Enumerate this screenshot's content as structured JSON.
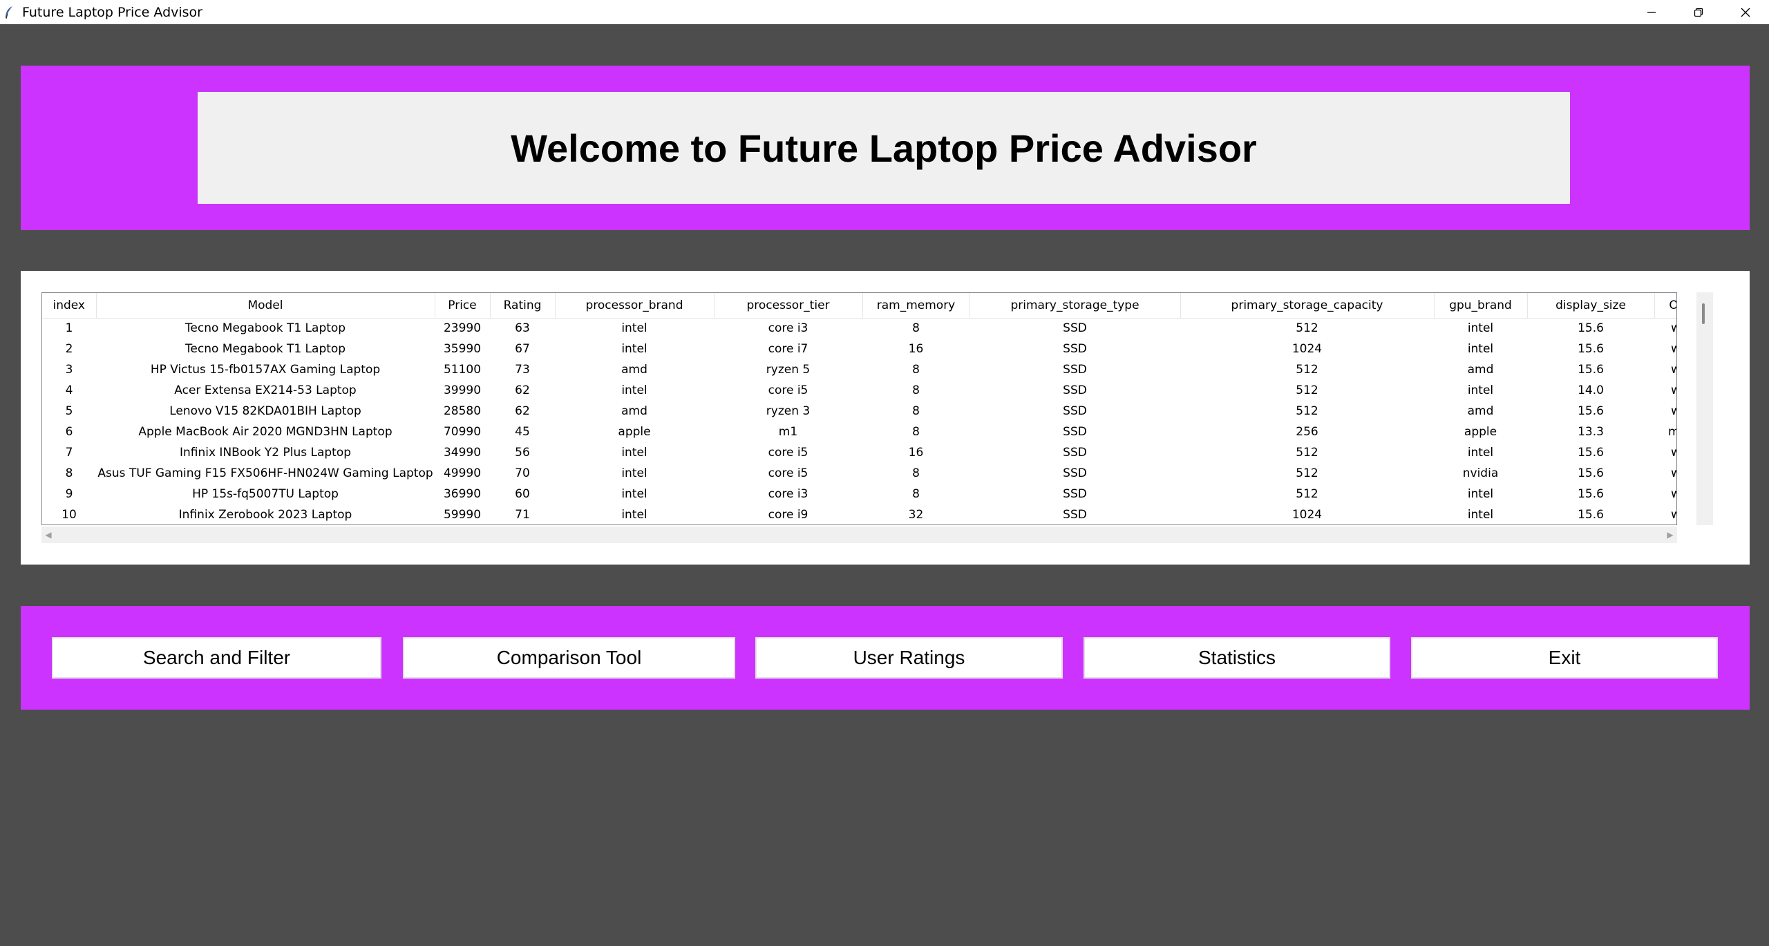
{
  "window": {
    "title": "Future Laptop Price Advisor",
    "app_icon": "feather-icon",
    "controls": [
      "minimize-icon",
      "restore-icon",
      "close-icon"
    ]
  },
  "header": {
    "title": "Welcome to Future Laptop Price Advisor"
  },
  "table": {
    "columns": [
      "index",
      "Model",
      "Price",
      "Rating",
      "processor_brand",
      "processor_tier",
      "ram_memory",
      "primary_storage_type",
      "primary_storage_capacity",
      "gpu_brand",
      "display_size",
      "OS"
    ],
    "rows": [
      [
        "1",
        "Tecno Megabook T1 Laptop",
        "23990",
        "63",
        "intel",
        "core i3",
        "8",
        "SSD",
        "512",
        "intel",
        "15.6",
        "wi"
      ],
      [
        "2",
        "Tecno Megabook T1 Laptop",
        "35990",
        "67",
        "intel",
        "core i7",
        "16",
        "SSD",
        "1024",
        "intel",
        "15.6",
        "wi"
      ],
      [
        "3",
        "HP Victus 15-fb0157AX Gaming Laptop",
        "51100",
        "73",
        "amd",
        "ryzen 5",
        "8",
        "SSD",
        "512",
        "amd",
        "15.6",
        "wi"
      ],
      [
        "4",
        "Acer Extensa EX214-53 Laptop",
        "39990",
        "62",
        "intel",
        "core i5",
        "8",
        "SSD",
        "512",
        "intel",
        "14.0",
        "wi"
      ],
      [
        "5",
        "Lenovo V15 82KDA01BIH Laptop",
        "28580",
        "62",
        "amd",
        "ryzen 3",
        "8",
        "SSD",
        "512",
        "amd",
        "15.6",
        "wi"
      ],
      [
        "6",
        "Apple MacBook Air 2020 MGND3HN Laptop",
        "70990",
        "45",
        "apple",
        "m1",
        "8",
        "SSD",
        "256",
        "apple",
        "13.3",
        "ma"
      ],
      [
        "7",
        "Infinix INBook Y2 Plus Laptop",
        "34990",
        "56",
        "intel",
        "core i5",
        "16",
        "SSD",
        "512",
        "intel",
        "15.6",
        "wi"
      ],
      [
        "8",
        "Asus TUF Gaming F15 FX506HF-HN024W Gaming Laptop",
        "49990",
        "70",
        "intel",
        "core i5",
        "8",
        "SSD",
        "512",
        "nvidia",
        "15.6",
        "wi"
      ],
      [
        "9",
        "HP 15s-fq5007TU Laptop",
        "36990",
        "60",
        "intel",
        "core i3",
        "8",
        "SSD",
        "512",
        "intel",
        "15.6",
        "wi"
      ],
      [
        "10",
        "Infinix Zerobook 2023 Laptop",
        "59990",
        "71",
        "intel",
        "core i9",
        "32",
        "SSD",
        "1024",
        "intel",
        "15.6",
        "wi"
      ]
    ]
  },
  "buttons": {
    "search": "Search and Filter",
    "compare": "Comparison Tool",
    "ratings": "User Ratings",
    "stats": "Statistics",
    "exit": "Exit"
  },
  "colors": {
    "background": "#4d4d4d",
    "accent": "#cc33ff",
    "header_box": "#f0f0f0"
  }
}
